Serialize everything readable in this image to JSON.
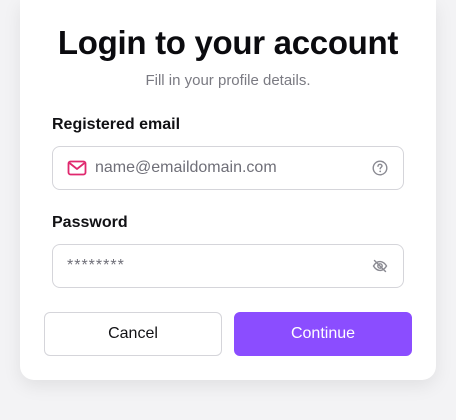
{
  "title": "Login to your account",
  "subtitle": "Fill in your profile details.",
  "email": {
    "label": "Registered email",
    "placeholder": "name@emaildomain.com",
    "lead_icon": "mail-icon",
    "trail_icon": "help-circle-icon",
    "icon_color": "#e0286e"
  },
  "password": {
    "label": "Password",
    "placeholder": "********",
    "trail_icon": "eye-off-icon"
  },
  "actions": {
    "cancel_label": "Cancel",
    "continue_label": "Continue",
    "accent": "#8b4dff"
  }
}
